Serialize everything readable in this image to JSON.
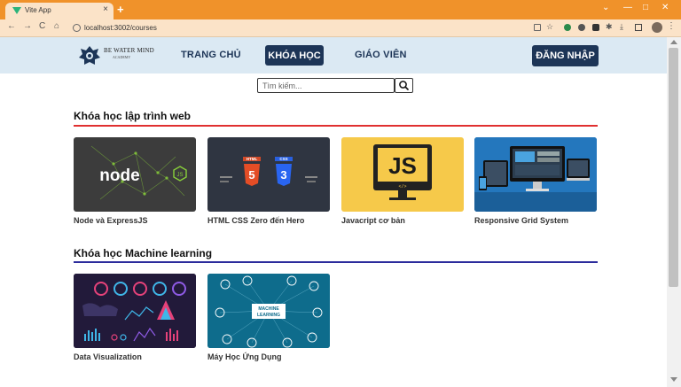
{
  "browser": {
    "tab_title": "Vite App",
    "tab_close": "×",
    "new_tab": "+",
    "url": "localhost:3002/courses",
    "window_controls": [
      "⌄",
      "—",
      "□",
      "✕"
    ]
  },
  "header": {
    "logo_text": "BE WATER MIND",
    "logo_sub": "ACADEMY",
    "nav": {
      "home": "TRANG CHỦ",
      "courses": "KHÓA HỌC",
      "teachers": "GIÁO VIÊN"
    },
    "login": "ĐĂNG NHẬP"
  },
  "search": {
    "placeholder": "Tìm kiếm..."
  },
  "sections": [
    {
      "title": "Khóa học lập trình web",
      "line_color": "#e03030",
      "courses": [
        {
          "label": "Node và ExpressJS"
        },
        {
          "label": "HTML CSS Zero đến Hero"
        },
        {
          "label": "Javacript cơ bản"
        },
        {
          "label": "Responsive Grid System"
        }
      ]
    },
    {
      "title": "Khóa học Machine learning",
      "line_color": "#2c2c9c",
      "courses": [
        {
          "label": "Data Visualization"
        },
        {
          "label": "Máy Học Ứng Dụng"
        }
      ]
    }
  ],
  "thumbnails": {
    "node": {
      "word": "node",
      "badge": "JS"
    },
    "html": {
      "html_tag": "HTML",
      "css_tag": "CSS",
      "html_num": "5",
      "css_num": "3"
    },
    "js": {
      "word": "JS",
      "sub": "</>"
    },
    "ml": {
      "line1": "MACHINE",
      "line2": "LEARNING"
    }
  }
}
